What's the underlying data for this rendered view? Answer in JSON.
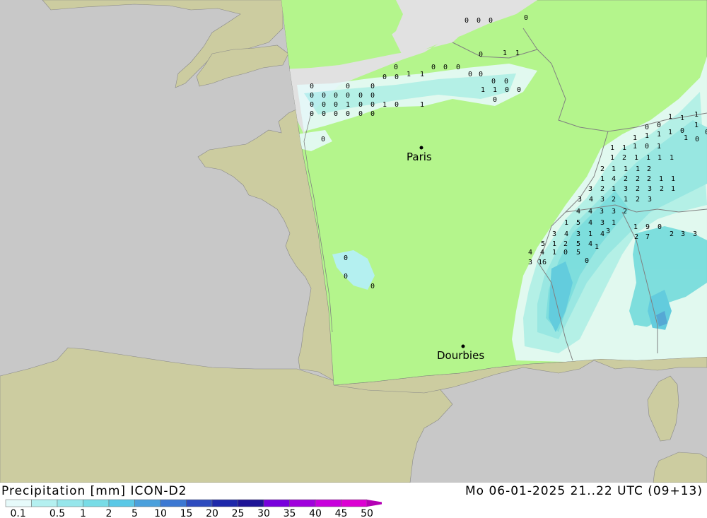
{
  "title": {
    "left": "Precipitation [mm] ICON-D2",
    "right": "Mo 06-01-2025 21..22 UTC (09+13)"
  },
  "cities": [
    {
      "name": "Paris"
    },
    {
      "name": "Dourbies"
    }
  ],
  "colors": {
    "sea": "#c8c8c8",
    "land_outside": "#cccca0",
    "model_domain": "#b4f58c",
    "north_sea": "#e1e1e1",
    "border": "#808080"
  },
  "legend": {
    "labels": [
      "0.1",
      "0.5",
      "1",
      "2",
      "5",
      "10",
      "15",
      "20",
      "25",
      "30",
      "35",
      "40",
      "45",
      "50"
    ],
    "colors": [
      "#e6fafa",
      "#b4f0f0",
      "#96e6eb",
      "#78dce6",
      "#5ac8e6",
      "#4ba0dc",
      "#3c78d2",
      "#2d4bbe",
      "#1e28aa",
      "#1e1496",
      "#7800dc",
      "#a000dc",
      "#c800dc",
      "#dc00d2",
      "#b400b4"
    ]
  },
  "precip_values": [
    "0",
    "0",
    "0",
    "0",
    "0",
    "0",
    "0",
    "0",
    "0",
    "0",
    "0",
    "0",
    "0",
    "0",
    "0",
    "0",
    "0",
    "0",
    "0",
    "0",
    "0",
    "0",
    "0",
    "0",
    "0",
    "1",
    "0",
    "0",
    "1",
    "0",
    "1",
    "1",
    "1",
    "0",
    "0",
    "0",
    "0",
    "0",
    "0",
    "0",
    "1",
    "1",
    "0",
    "0",
    "0",
    "1",
    "1",
    "0",
    "0",
    "0",
    "0",
    "0",
    "1",
    "0",
    "1",
    "0",
    "0",
    "0",
    "1",
    "1",
    "1",
    "1",
    "1",
    "1",
    "0",
    "1",
    "1",
    "0",
    "1",
    "1",
    "1",
    "1",
    "2",
    "1",
    "1",
    "1",
    "1",
    "2",
    "1",
    "1",
    "1",
    "2",
    "1",
    "4",
    "2",
    "2",
    "2",
    "1",
    "1",
    "3",
    "2",
    "1",
    "3",
    "2",
    "3",
    "2",
    "1",
    "3",
    "4",
    "3",
    "2",
    "1",
    "2",
    "3",
    "4",
    "4",
    "3",
    "3",
    "2",
    "1",
    "5",
    "4",
    "3",
    "1",
    "3",
    "4",
    "3",
    "1",
    "4",
    "3",
    "5",
    "1",
    "2",
    "5",
    "4",
    "1",
    "4",
    "4",
    "1",
    "0",
    "5",
    "0",
    "1",
    "9",
    "0",
    "2",
    "3",
    "3",
    "2",
    "7",
    "3",
    "16",
    "2",
    "2",
    "3",
    "1",
    "2",
    "1",
    "2",
    "0",
    "1"
  ]
}
